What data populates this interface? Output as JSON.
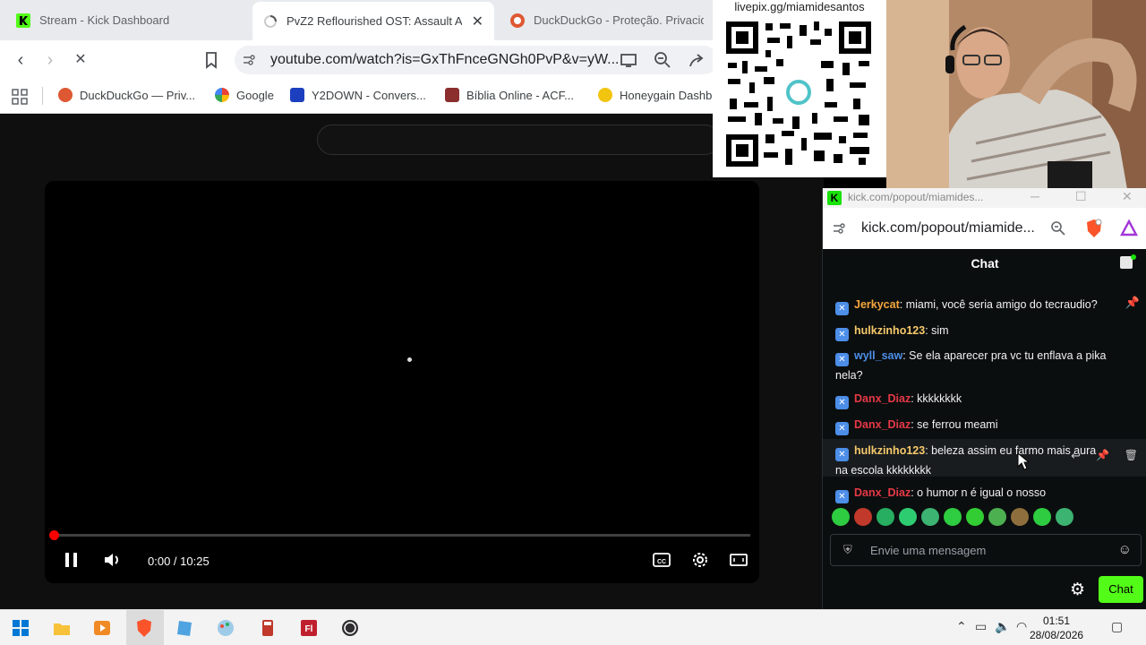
{
  "browser": {
    "tabs": [
      {
        "title": "Stream - Kick Dashboard",
        "active": false
      },
      {
        "title": "PvZ2 Reflourished OST: Assault A",
        "active": true
      },
      {
        "title": "DuckDuckGo - Proteção. Privacidad",
        "active": false
      }
    ],
    "url": "youtube.com/watch?is=GxThFnceGNGh0PvP&v=yW...",
    "bookmarks": [
      {
        "label": "DuckDuckGo — Priv..."
      },
      {
        "label": "Google"
      },
      {
        "label": "Y2DOWN - Convers..."
      },
      {
        "label": "Bíblia Online - ACF..."
      },
      {
        "label": "Honeygain Dashb"
      }
    ]
  },
  "player": {
    "time": "0:00 / 10:25",
    "progress_fraction": 0.0
  },
  "qr": {
    "title": "livepix.gg/miamidesantos"
  },
  "popout": {
    "window_title": "kick.com/popout/miamides...",
    "url": "kick.com/popout/miamide...",
    "chat_title": "Chat",
    "messages": [
      {
        "user": "Jerkycat",
        "color": "#f5a63d",
        "text": ": miami, você seria amigo do tecraudio?"
      },
      {
        "user": "hulkzinho123",
        "color": "#f5c96b",
        "text": ": sim"
      },
      {
        "user": "wyll_saw",
        "color": "#4c8ee8",
        "text": ": Se ela aparecer pra vc tu enflava a pika nela?"
      },
      {
        "user": "Danx_Diaz",
        "color": "#e63946",
        "text": ": kkkkkkkk"
      },
      {
        "user": "Danx_Diaz",
        "color": "#e63946",
        "text": ": se ferrou meami"
      },
      {
        "user": "hulkzinho123",
        "color": "#f5c96b",
        "text": ": beleza assim eu farmo mais aura na escola kkkkkkkk"
      },
      {
        "user": "Danx_Diaz",
        "color": "#e63946",
        "text": ": o humor n é igual o nosso"
      }
    ],
    "input_placeholder": "Envie uma mensagem",
    "send_label": "Chat",
    "emotes": [
      "#2ecc40",
      "#c0392b",
      "#27ae60",
      "#2ecc71",
      "#3cb371",
      "#2ecc40",
      "#32cd32",
      "#4caf50",
      "#8e6e3d",
      "#2ecc40",
      "#3cb371"
    ]
  },
  "taskbar": {
    "time": "01:51",
    "date": "28/08/2026"
  }
}
